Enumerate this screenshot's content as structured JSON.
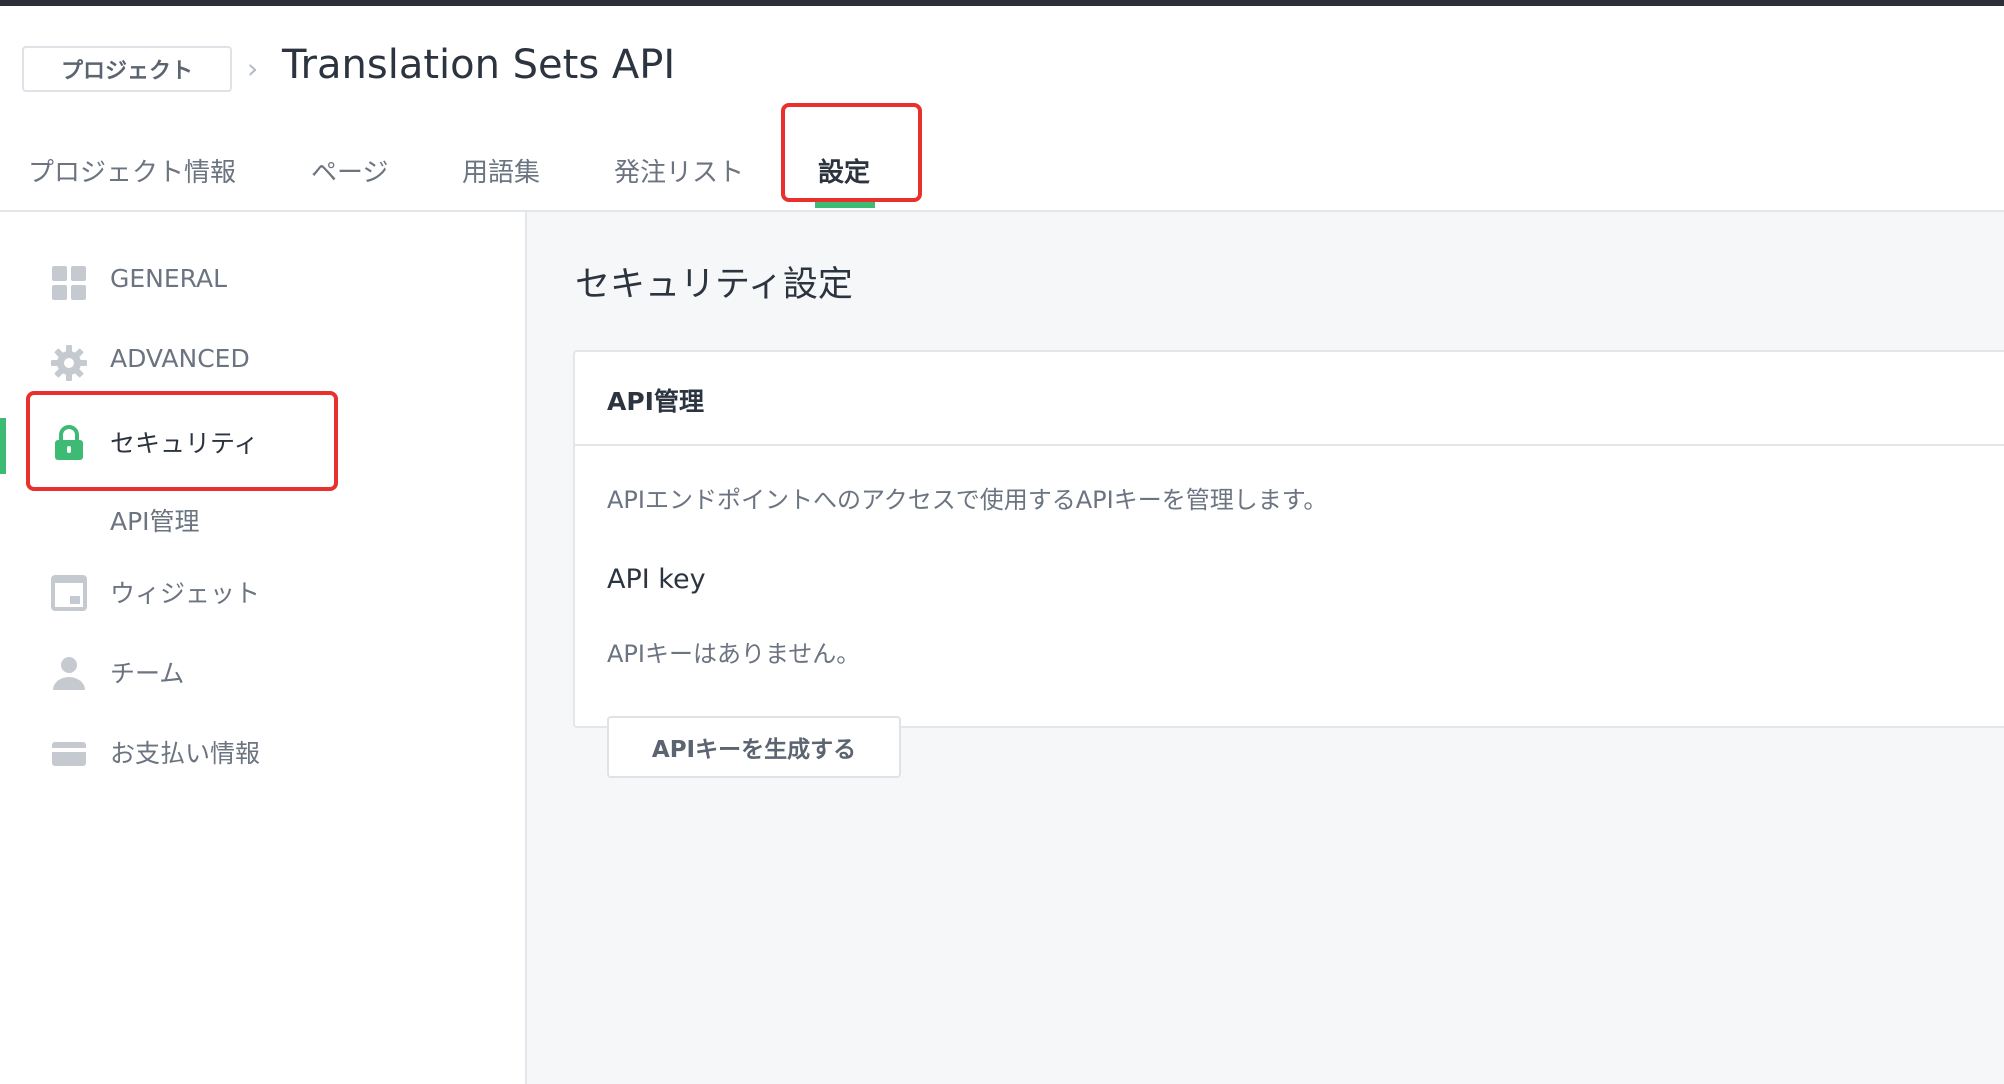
{
  "header": {
    "breadcrumb_label": "プロジェクト",
    "chevron": "›",
    "title": "Translation Sets API"
  },
  "tabs": [
    {
      "label": "プロジェクト情報",
      "active": false
    },
    {
      "label": "ページ",
      "active": false
    },
    {
      "label": "用語集",
      "active": false
    },
    {
      "label": "発注リスト",
      "active": false
    },
    {
      "label": "設定",
      "active": true
    }
  ],
  "sidebar": {
    "items": [
      {
        "label": "GENERAL",
        "icon": "grid-icon"
      },
      {
        "label": "ADVANCED",
        "icon": "gear-icon"
      },
      {
        "label": "セキュリティ",
        "icon": "lock-icon",
        "active": true
      },
      {
        "label": "ウィジェット",
        "icon": "widget-icon"
      },
      {
        "label": "チーム",
        "icon": "user-icon"
      },
      {
        "label": "お支払い情報",
        "icon": "credit-card-icon"
      }
    ],
    "sub_item": "API管理"
  },
  "main": {
    "section_title": "セキュリティ設定",
    "card": {
      "title": "API管理",
      "description": "APIエンドポイントへのアクセスで使用するAPIキーを管理します。",
      "key_heading": "API key",
      "no_key_text": "APIキーはありません。",
      "generate_button": "APIキーを生成する"
    }
  },
  "colors": {
    "accent": "#3dbb74",
    "highlight": "#e8302c",
    "icon_gray": "#c5cad1"
  }
}
